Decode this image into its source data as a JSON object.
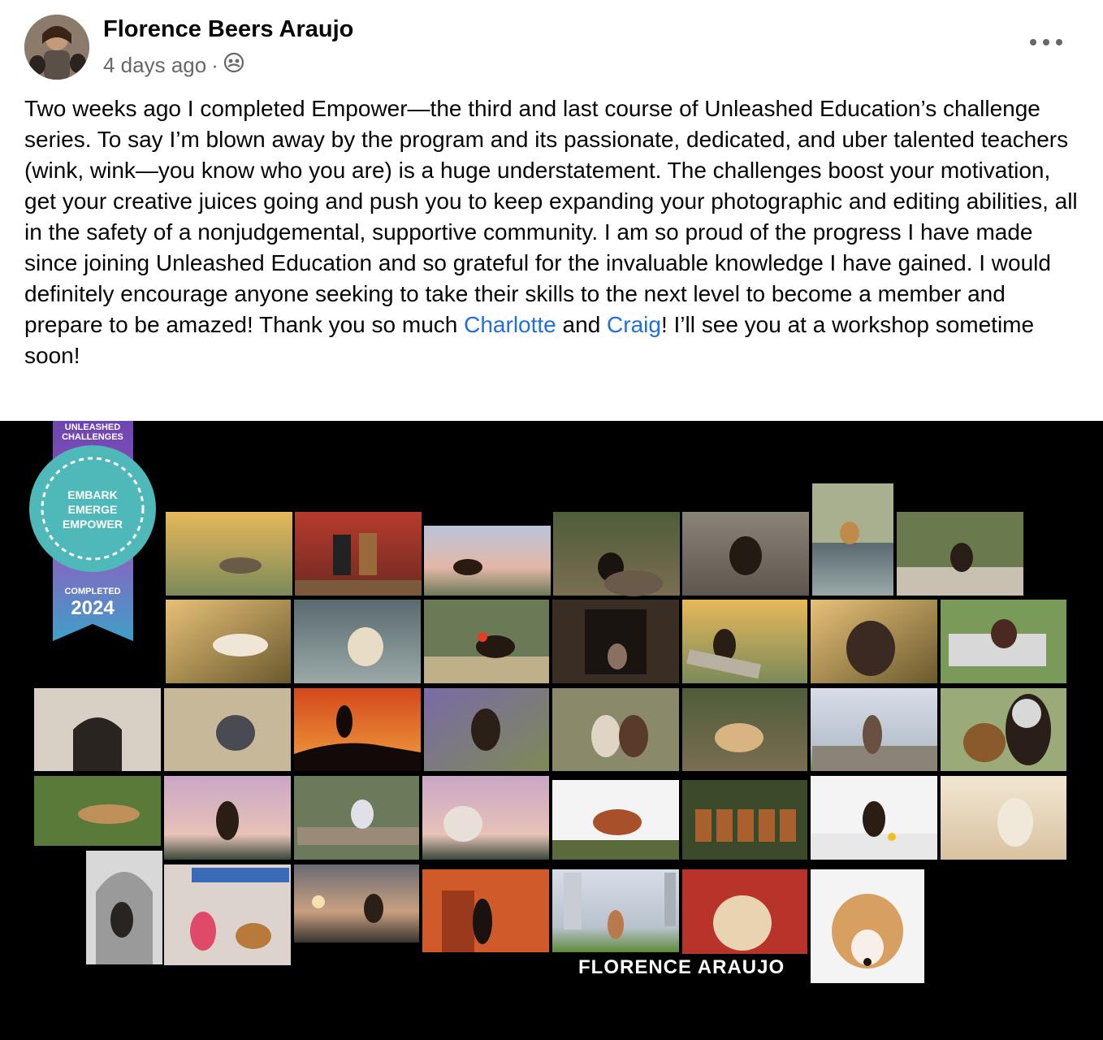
{
  "post": {
    "author_name": "Florence Beers Araujo",
    "timestamp": "4 days ago",
    "separator": "·",
    "audience_icon": "group-icon",
    "more_icon": "more-options-icon",
    "text_before_link1": "Two weeks ago I completed Empower—the third and last course of Unleashed Education’s challenge series. To say I’m blown away by the program and its passionate, dedicated, and uber talented teachers (wink, wink—you know who you are) is a huge understatement. The challenges boost your motivation, get your creative juices going and push you to keep expanding your photographic and editing abilities, all in the safety of a nonjudgemental, supportive community. I am so proud of the progress I have made since joining Unleashed Education and so grateful for the invaluable knowledge I have gained. I would definitely encourage anyone seeking to take their skills to the next level to become a member and prepare to be amazed! Thank you so much ",
    "link1": "Charlotte",
    "text_between_links": " and ",
    "link2": "Craig",
    "text_after_link2": "! I’ll see you at a workshop sometime soon!",
    "link_color": "#216fdb"
  },
  "image": {
    "ribbon_top_line1": "UNLEASHED",
    "ribbon_top_line2": "CHALLENGES",
    "badge_line1": "EMBARK",
    "badge_line2": "EMERGE",
    "badge_line3": "EMPOWER",
    "completed_label": "COMPLETED",
    "completed_year": "2024",
    "watermark": "FLORENCE ARAUJO",
    "badge_color": "#4fb8b8",
    "ribbon_color": "#7a4fb8"
  }
}
